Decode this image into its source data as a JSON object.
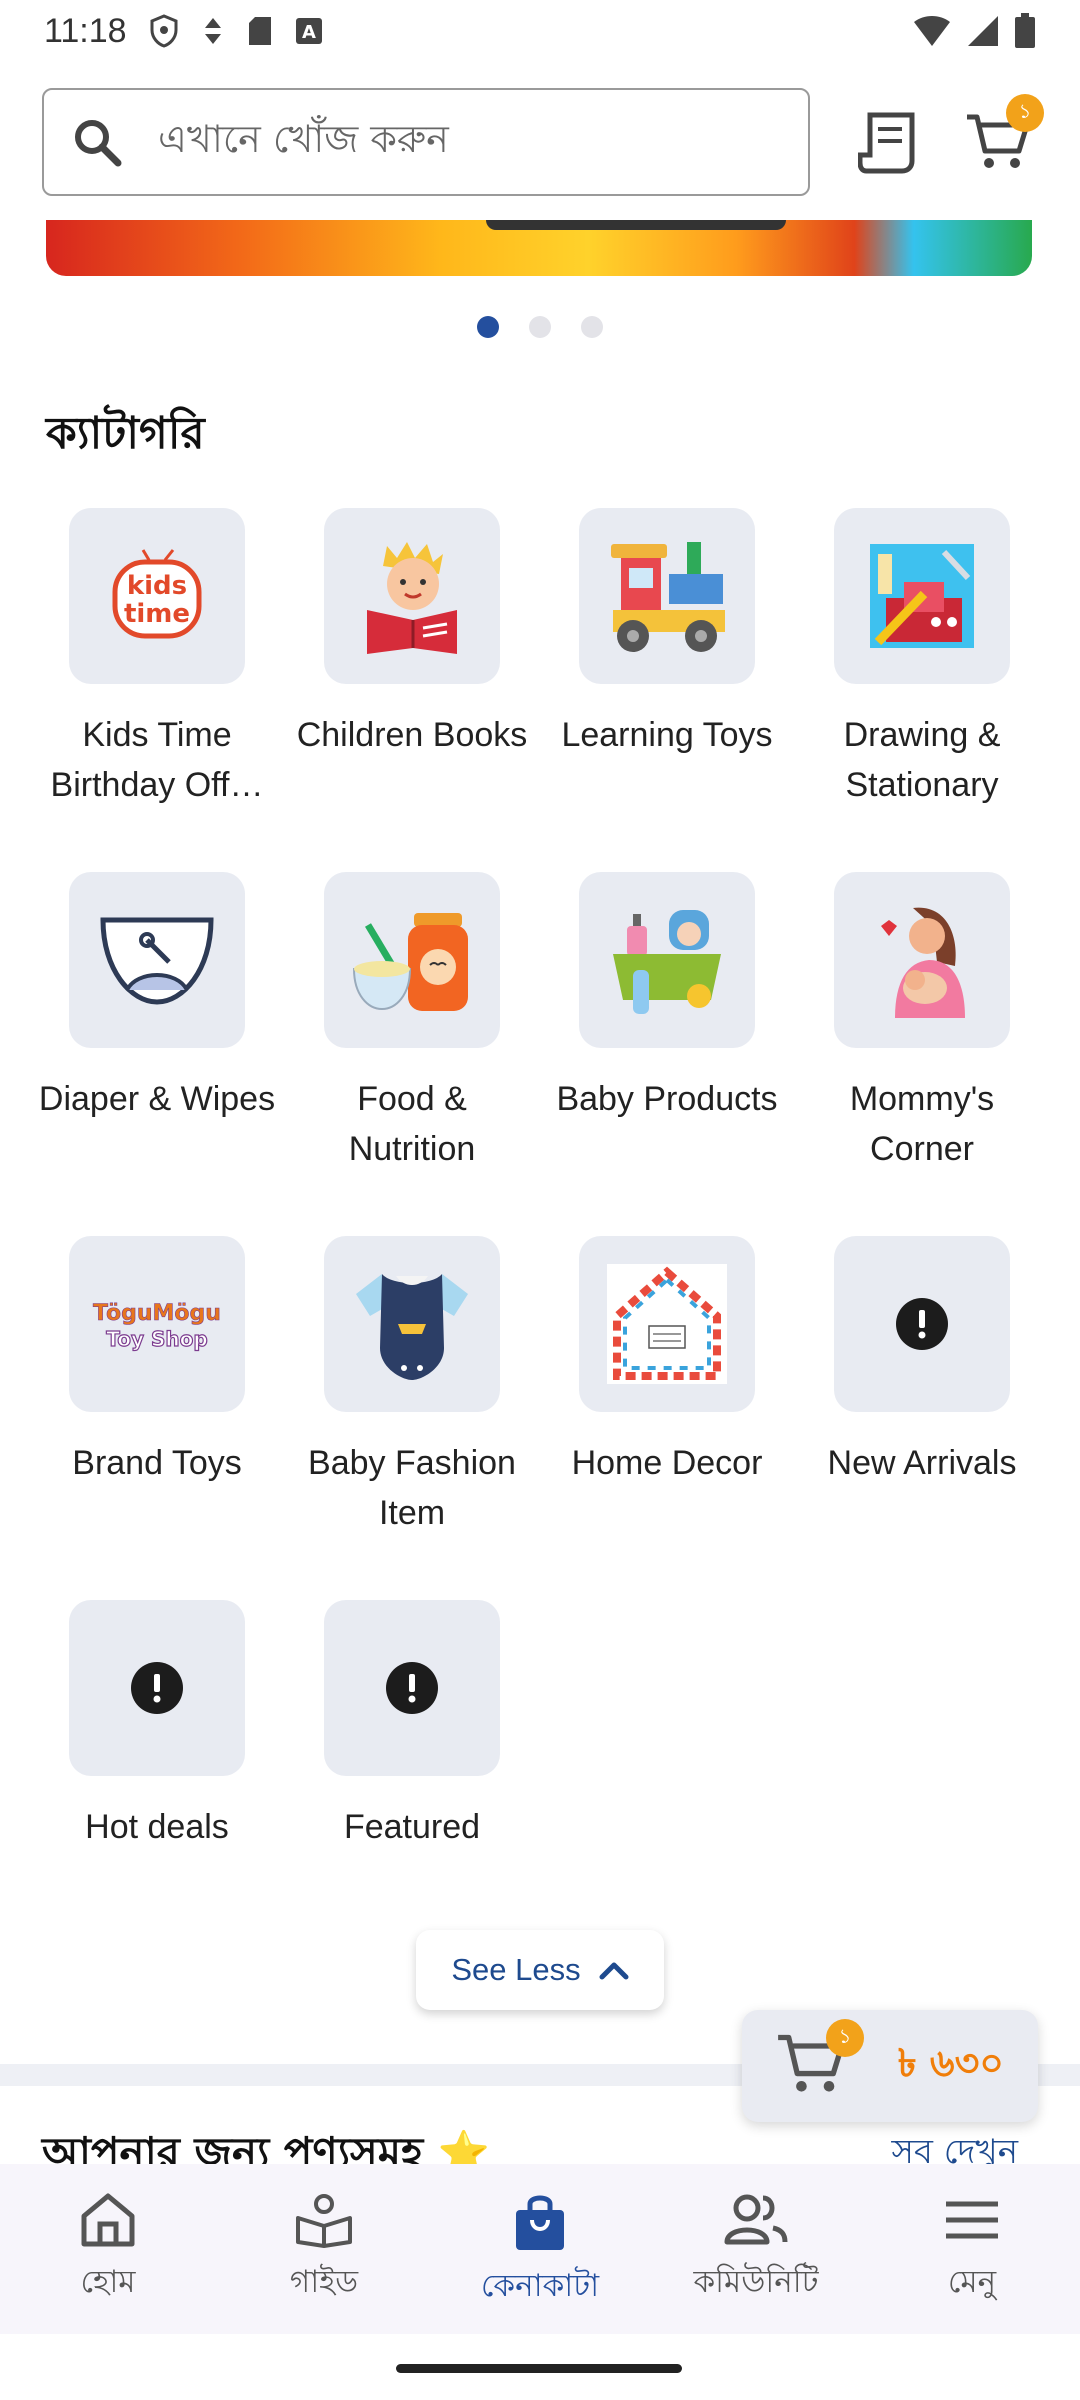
{
  "status_bar": {
    "time": "11:18"
  },
  "search": {
    "placeholder": "এখানে খোঁজ করুন"
  },
  "header": {
    "cart_count": "১"
  },
  "carousel": {
    "dots": 3,
    "active_index": 0
  },
  "categories": {
    "title": "ক্যাটাগরি",
    "items": [
      {
        "label": "Kids Time Birthday Off…",
        "icon": "kids-time-logo"
      },
      {
        "label": "Children Books",
        "icon": "child-reading-book"
      },
      {
        "label": "Learning Toys",
        "icon": "toy-train"
      },
      {
        "label": "Drawing & Stationary",
        "icon": "stationery-set"
      },
      {
        "label": "Diaper & Wipes",
        "icon": "diaper"
      },
      {
        "label": "Food & Nutrition",
        "icon": "baby-food-jar"
      },
      {
        "label": "Baby Products",
        "icon": "baby-products-basket"
      },
      {
        "label": "Mommy's Corner",
        "icon": "mother-with-baby"
      },
      {
        "label": "Brand Toys",
        "icon": "togu-mogu-logo",
        "logo_text": [
          "TöguMögu",
          "Toy Shop"
        ]
      },
      {
        "label": "Baby Fashion Item",
        "icon": "baby-romper"
      },
      {
        "label": "Home Decor",
        "icon": "home-decor-house"
      },
      {
        "label": "New Arrivals",
        "icon": "exclamation-icon"
      },
      {
        "label": "Hot deals",
        "icon": "exclamation-icon"
      },
      {
        "label": "Featured",
        "icon": "exclamation-icon"
      }
    ]
  },
  "see_less": {
    "label": "See Less"
  },
  "floating_cart": {
    "count": "১",
    "price": "৳ ৬৩০"
  },
  "products": {
    "title": "আপনার জন্য পণ্যসমূহ ⭐",
    "see_all": "সব দেখুন"
  },
  "bottom_nav": [
    {
      "label": "হোম",
      "icon": "home-icon",
      "active": false
    },
    {
      "label": "গাইড",
      "icon": "guide-icon",
      "active": false
    },
    {
      "label": "কেনাকাটা",
      "icon": "shopping-bag-icon",
      "active": true
    },
    {
      "label": "কমিউনিটি",
      "icon": "community-icon",
      "active": false
    },
    {
      "label": "মেনু",
      "icon": "menu-icon",
      "active": false
    }
  ],
  "colors": {
    "primary": "#244f9e",
    "accent": "#f2a21a",
    "tile_bg": "#e8ebf2"
  }
}
